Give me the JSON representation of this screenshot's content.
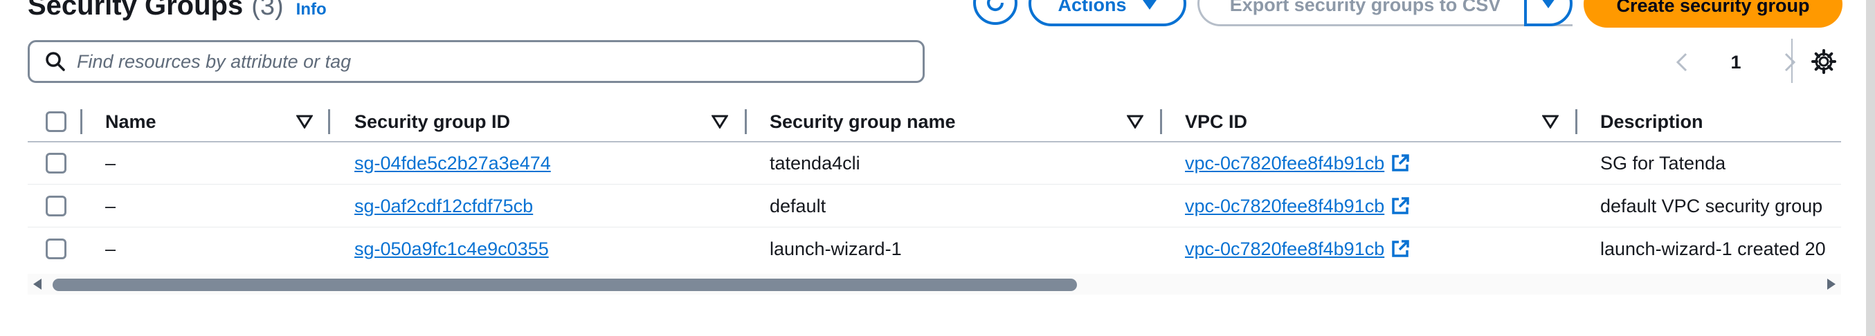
{
  "header": {
    "title": "Security Groups",
    "count": "(3)",
    "info_label": "Info",
    "actions_label": "Actions",
    "export_label": "Export security groups to CSV",
    "create_label": "Create security group"
  },
  "search": {
    "placeholder": "Find resources by attribute or tag"
  },
  "pagination": {
    "current_page": "1"
  },
  "table": {
    "columns": [
      "Name",
      "Security group ID",
      "Security group name",
      "VPC ID",
      "Description"
    ],
    "rows": [
      {
        "name": "–",
        "sg_id": "sg-04fde5c2b27a3e474",
        "sg_name": "tatenda4cli",
        "vpc_id": "vpc-0c7820fee8f4b91cb",
        "description": "SG for Tatenda"
      },
      {
        "name": "–",
        "sg_id": "sg-0af2cdf12cfdf75cb",
        "sg_name": "default",
        "vpc_id": "vpc-0c7820fee8f4b91cb",
        "description": "default VPC security group"
      },
      {
        "name": "–",
        "sg_id": "sg-050a9fc1c4e9c0355",
        "sg_name": "launch-wizard-1",
        "vpc_id": "vpc-0c7820fee8f4b91cb",
        "description": "launch-wizard-1 created 20"
      }
    ]
  },
  "colors": {
    "link": "#0972d3",
    "primary_button": "#ff9900",
    "border": "#7d8998"
  }
}
